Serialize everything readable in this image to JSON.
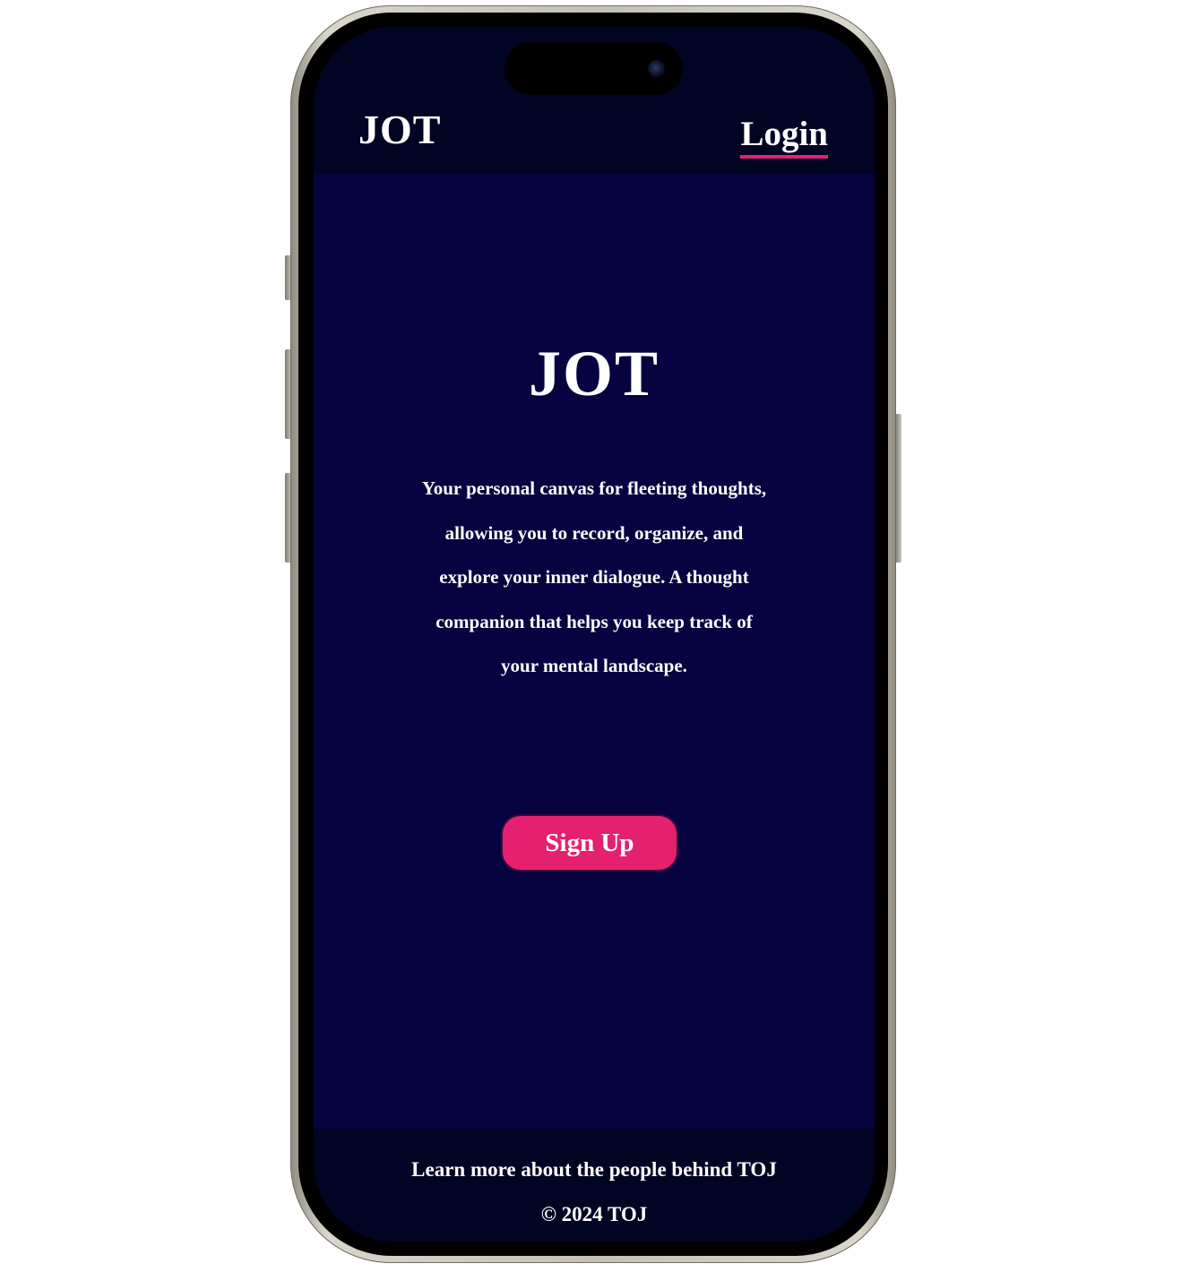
{
  "header": {
    "brand": "JOT",
    "login_label": "Login"
  },
  "hero": {
    "title": "JOT",
    "description": "Your personal canvas for fleeting thoughts, allowing you to record, organize, and explore your inner dialogue. A thought companion that helps you keep track of your mental landscape.",
    "signup_label": "Sign Up"
  },
  "footer": {
    "about_link": "Learn more about the people behind TOJ",
    "copyright": "© 2024 TOJ"
  },
  "colors": {
    "header_bg": "#020423",
    "page_bg": "#060340",
    "accent": "#e5216f",
    "text": "#ffffff"
  }
}
